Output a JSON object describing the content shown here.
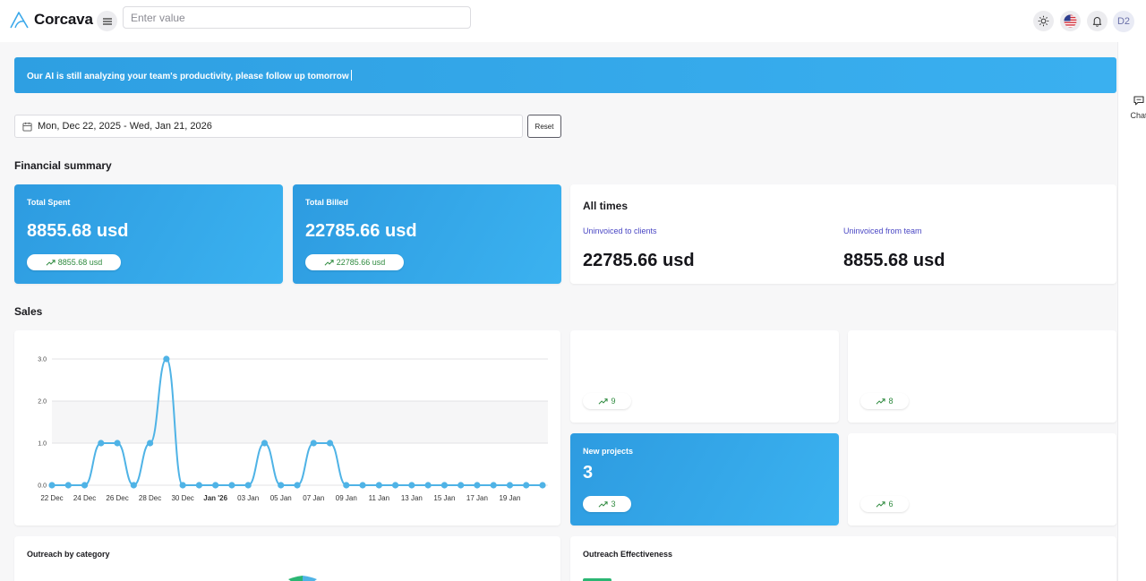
{
  "header": {
    "logo_text": "Corcava",
    "search_placeholder": "Enter value",
    "avatar_initials": "D2"
  },
  "rail": {
    "chat_label": "Chat"
  },
  "banner": {
    "text": "Our AI is still analyzing your team's productivity, please follow up tomorrow"
  },
  "filters": {
    "date_range": "Mon, Dec 22, 2025 - Wed, Jan 21, 2026",
    "reset_label": "Reset"
  },
  "financial": {
    "title": "Financial summary",
    "total_spent": {
      "label": "Total Spent",
      "value": "8855.68 usd",
      "trend": "8855.68 usd"
    },
    "total_billed": {
      "label": "Total Billed",
      "value": "22785.66 usd",
      "trend": "22785.66 usd"
    },
    "all_times": {
      "title": "All times",
      "uninvoiced_clients_label": "Uninvoiced to clients",
      "uninvoiced_clients_value": "22785.66 usd",
      "uninvoiced_team_label": "Uninvoiced from team",
      "uninvoiced_team_value": "8855.68 usd"
    }
  },
  "sales": {
    "title": "Sales",
    "stat_cards": [
      {
        "label": "",
        "value": "",
        "trend": "9"
      },
      {
        "label": "",
        "value": "",
        "trend": "8"
      },
      {
        "label": "New projects",
        "value": "3",
        "trend": "3"
      },
      {
        "label": "",
        "value": "",
        "trend": "6"
      }
    ]
  },
  "outreach": {
    "by_category_title": "Outreach by category",
    "effectiveness_title": "Outreach Effectiveness"
  },
  "colors": {
    "accent": "#3aa8ea",
    "line": "#4fb3e6",
    "trend_green": "#2e8a3e",
    "link_purple": "#4a47c4"
  },
  "chart_data": {
    "type": "line",
    "x": [
      "22 Dec",
      "23 Dec",
      "24 Dec",
      "25 Dec",
      "26 Dec",
      "27 Dec",
      "28 Dec",
      "29 Dec",
      "30 Dec",
      "31 Dec",
      "Jan '26",
      "02 Jan",
      "03 Jan",
      "04 Jan",
      "05 Jan",
      "06 Jan",
      "07 Jan",
      "08 Jan",
      "09 Jan",
      "10 Jan",
      "11 Jan",
      "12 Jan",
      "13 Jan",
      "14 Jan",
      "15 Jan",
      "16 Jan",
      "17 Jan",
      "18 Jan",
      "19 Jan",
      "20 Jan",
      "21 Jan"
    ],
    "x_tick_labels": [
      "22 Dec",
      "24 Dec",
      "26 Dec",
      "28 Dec",
      "30 Dec",
      "Jan '26",
      "03 Jan",
      "05 Jan",
      "07 Jan",
      "09 Jan",
      "11 Jan",
      "13 Jan",
      "15 Jan",
      "17 Jan",
      "19 Jan"
    ],
    "values": [
      0,
      0,
      0,
      1,
      1,
      0,
      1,
      3,
      0,
      0,
      0,
      0,
      0,
      1,
      0,
      0,
      1,
      1,
      0,
      0,
      0,
      0,
      0,
      0,
      0,
      0,
      0,
      0,
      0,
      0,
      0
    ],
    "y_ticks": [
      "0.0",
      "1.0",
      "2.0",
      "3.0"
    ],
    "ylim": [
      0,
      3
    ],
    "grid": true
  }
}
